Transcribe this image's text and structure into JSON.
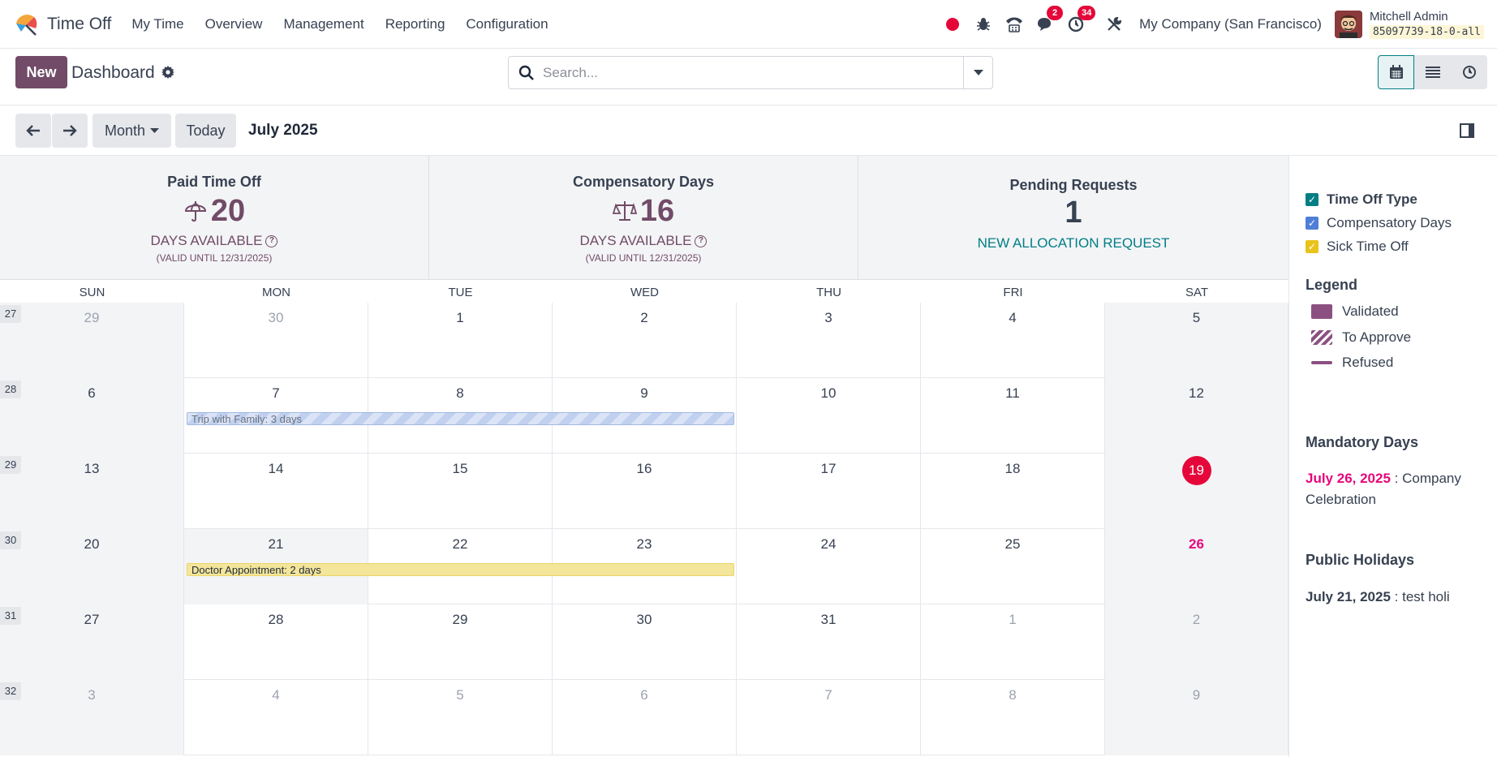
{
  "navbar": {
    "app_title": "Time Off",
    "menu": [
      "My Time",
      "Overview",
      "Management",
      "Reporting",
      "Configuration"
    ],
    "messages_badge": "2",
    "activities_badge": "34",
    "company": "My Company (San Francisco)",
    "user_name": "Mitchell Admin",
    "database": "85097739-18-0-all"
  },
  "control": {
    "new_label": "New",
    "page_title": "Dashboard",
    "search_placeholder": "Search..."
  },
  "toolbar": {
    "scale": "Month",
    "today_label": "Today",
    "period": "July 2025"
  },
  "cards": {
    "paid": {
      "title": "Paid Time Off",
      "value": "20",
      "sub": "DAYS AVAILABLE",
      "valid": "(VALID UNTIL 12/31/2025)"
    },
    "comp": {
      "title": "Compensatory Days",
      "value": "16",
      "sub": "DAYS AVAILABLE",
      "valid": "(VALID UNTIL 12/31/2025)"
    },
    "pending": {
      "title": "Pending Requests",
      "value": "1",
      "link": "NEW ALLOCATION REQUEST"
    }
  },
  "weekdays": [
    "SUN",
    "MON",
    "TUE",
    "WED",
    "THU",
    "FRI",
    "SAT"
  ],
  "weeks": [
    {
      "num": "27",
      "days": [
        "29",
        "30",
        "1",
        "2",
        "3",
        "4",
        "5"
      ],
      "muted": [
        0,
        1
      ]
    },
    {
      "num": "28",
      "days": [
        "6",
        "7",
        "8",
        "9",
        "10",
        "11",
        "12"
      ],
      "muted": []
    },
    {
      "num": "29",
      "days": [
        "13",
        "14",
        "15",
        "16",
        "17",
        "18",
        "19"
      ],
      "muted": []
    },
    {
      "num": "30",
      "days": [
        "20",
        "21",
        "22",
        "23",
        "24",
        "25",
        "26"
      ],
      "muted": []
    },
    {
      "num": "31",
      "days": [
        "27",
        "28",
        "29",
        "30",
        "31",
        "1",
        "2"
      ],
      "muted": [
        5,
        6
      ]
    },
    {
      "num": "32",
      "days": [
        "3",
        "4",
        "5",
        "6",
        "7",
        "8",
        "9"
      ],
      "muted": [
        0,
        1,
        2,
        3,
        4,
        5,
        6
      ]
    }
  ],
  "today": {
    "week": 2,
    "day": 6
  },
  "mandatory_highlight": {
    "week": 3,
    "day": 6
  },
  "holiday_highlight": {
    "week": 3,
    "day": 1
  },
  "events": [
    {
      "label": "Trip with Family: 3 days",
      "week": 1,
      "start": 1,
      "end": 3,
      "status": "to-approve"
    },
    {
      "label": "Doctor Appointment: 2 days",
      "week": 3,
      "start": 1,
      "end": 3,
      "status": "sick"
    }
  ],
  "sidebar": {
    "filters": [
      {
        "label": "Time Off Type",
        "color": "#017e84",
        "bold": true
      },
      {
        "label": "Compensatory Days",
        "color": "#4f7ed6",
        "bold": false
      },
      {
        "label": "Sick Time Off",
        "color": "#e9c31c",
        "bold": false
      }
    ],
    "legend_title": "Legend",
    "legend": [
      "Validated",
      "To Approve",
      "Refused"
    ],
    "mandatory_title": "Mandatory Days",
    "mandatory_date": "July 26, 2025",
    "mandatory_name": " : Company Celebration",
    "holidays_title": "Public Holidays",
    "holiday_date": "July 21, 2025",
    "holiday_name": " : test holi"
  },
  "colors": {
    "brand": "#714b67",
    "accent": "#017e84",
    "danger": "#e5073a",
    "mandatory": "#e5077b"
  }
}
